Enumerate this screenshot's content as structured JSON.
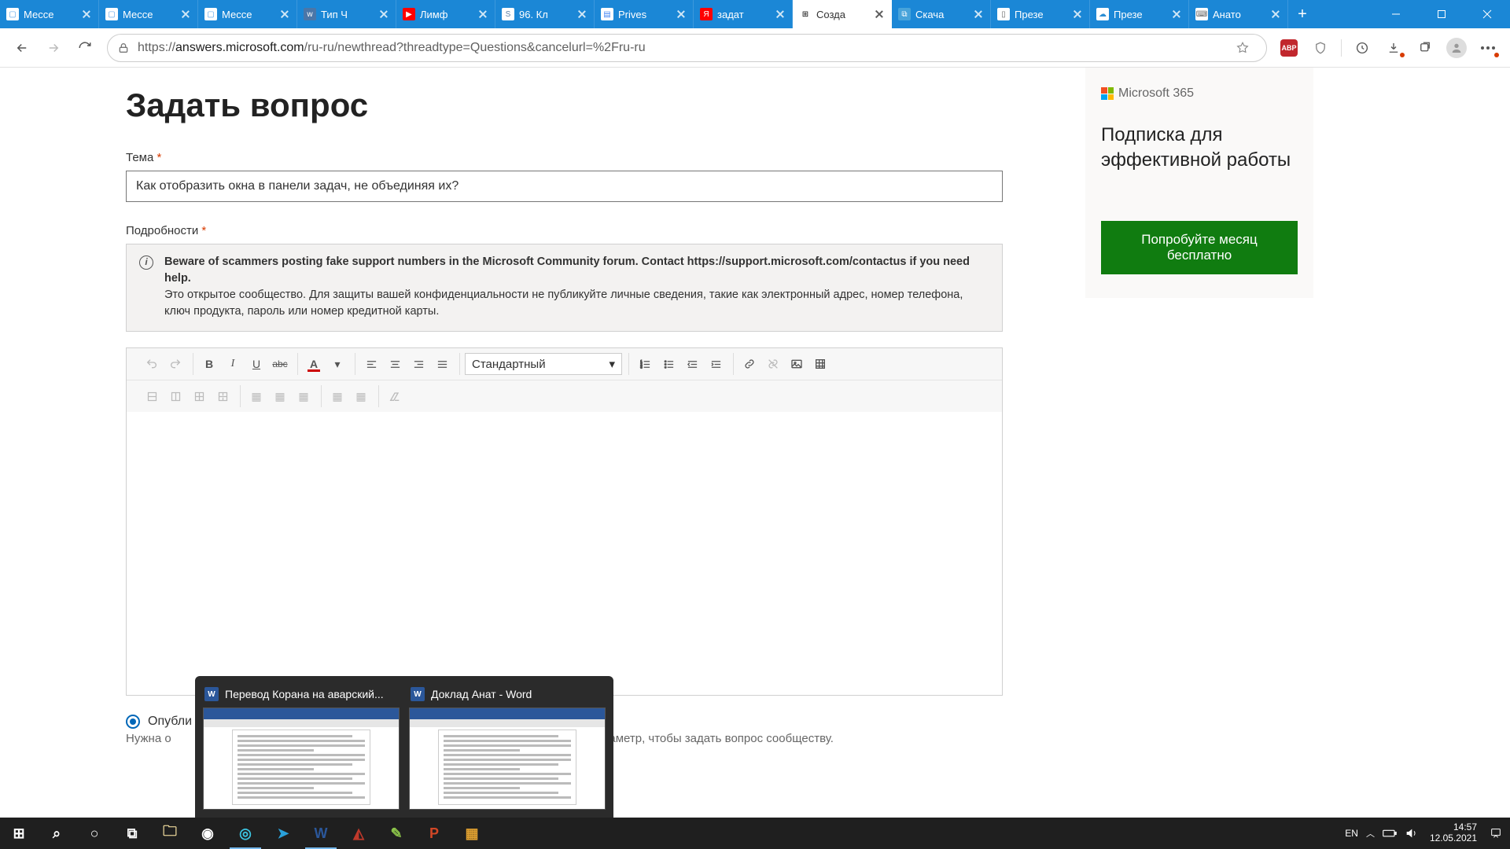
{
  "tabs": [
    {
      "title": "Мессе",
      "fav_bg": "#ffffff",
      "fav_fg": "#54a0e8",
      "fav_txt": "▢"
    },
    {
      "title": "Мессе",
      "fav_bg": "#ffffff",
      "fav_fg": "#54a0e8",
      "fav_txt": "▢"
    },
    {
      "title": "Мессе",
      "fav_bg": "#ffffff",
      "fav_fg": "#54a0e8",
      "fav_txt": "▢"
    },
    {
      "title": "Тип Ч",
      "fav_bg": "#4a76a8",
      "fav_fg": "#ffffff",
      "fav_txt": "w"
    },
    {
      "title": "Лимф",
      "fav_bg": "#ff0000",
      "fav_fg": "#ffffff",
      "fav_txt": "▶"
    },
    {
      "title": "96. Кл",
      "fav_bg": "#ffffff",
      "fav_fg": "#5b7fa6",
      "fav_txt": "S"
    },
    {
      "title": "Prives",
      "fav_bg": "#ffffff",
      "fav_fg": "#4285f4",
      "fav_txt": "▤"
    },
    {
      "title": "задат",
      "fav_bg": "#ff0000",
      "fav_fg": "#ffffff",
      "fav_txt": "Я"
    },
    {
      "title": "Созда",
      "fav_bg": "#ffffff",
      "fav_fg": "#000000",
      "fav_txt": "⊞",
      "active": true
    },
    {
      "title": "Скача",
      "fav_bg": "#47a3da",
      "fav_fg": "#ffffff",
      "fav_txt": "⧉"
    },
    {
      "title": "Презе",
      "fav_bg": "#ffffff",
      "fav_fg": "#666666",
      "fav_txt": "▯"
    },
    {
      "title": "Презе",
      "fav_bg": "#ffffff",
      "fav_fg": "#2a8dd4",
      "fav_txt": "☁"
    },
    {
      "title": "Анато",
      "fav_bg": "#ffffff",
      "fav_fg": "#666666",
      "fav_txt": "⌨"
    }
  ],
  "url": {
    "host": "answers.microsoft.com",
    "path": "/ru-ru/newthread?threadtype=Questions&cancelurl=%2Fru-ru",
    "prefix": "https://"
  },
  "abp_label": "ABP",
  "page_title": "Задать вопрос",
  "subject_label": "Тема",
  "subject_value": "Как отобразить окна в панели задач, не объединяя их?",
  "details_label": "Подробности",
  "info_bold": "Beware of scammers posting fake support numbers in the Microsoft Community forum. Contact https://support.microsoft.com/contactus if you need help.",
  "info_rest": "Это открытое сообщество. Для защиты вашей конфиденциальности не публикуйте личные сведения, такие как электронный адрес, номер телефона, ключ продукта, пароль или номер кредитной карты.",
  "style_select": "Стандартный",
  "font_color_letter": "A",
  "publish_label": "Опубли",
  "publish_hint_prefix": "Нужна о",
  "publish_hint_suffix": "араметр, чтобы задать вопрос сообществу.",
  "promo": {
    "brand": "Microsoft 365",
    "headline": "Подписка для эффективной работы",
    "cta": "Попробуйте месяц бесплатно"
  },
  "previews": [
    {
      "title": "Перевод Корана на аварский..."
    },
    {
      "title": "Доклад Анат - Word"
    }
  ],
  "tray": {
    "lang": "EN",
    "time": "14:57",
    "date": "12.05.2021"
  },
  "task_apps": [
    {
      "name": "start",
      "glyph": "⊞",
      "color": "#ffffff"
    },
    {
      "name": "search",
      "glyph": "⌕",
      "color": "#ffffff"
    },
    {
      "name": "cortana",
      "glyph": "○",
      "color": "#ffffff"
    },
    {
      "name": "taskview",
      "glyph": "⧉",
      "color": "#ffffff"
    },
    {
      "name": "explorer",
      "glyph": "🗀",
      "color": "#ffe9a6"
    },
    {
      "name": "chrome",
      "glyph": "◉",
      "color": "#ffffff"
    },
    {
      "name": "edge",
      "glyph": "◎",
      "color": "#3cc4e0",
      "active": true
    },
    {
      "name": "telegram",
      "glyph": "➤",
      "color": "#2aa1da"
    },
    {
      "name": "word",
      "glyph": "W",
      "color": "#2b579a",
      "active": true
    },
    {
      "name": "app-red",
      "glyph": "◭",
      "color": "#c0392b"
    },
    {
      "name": "notepadpp",
      "glyph": "✎",
      "color": "#8bc34a"
    },
    {
      "name": "powerpoint",
      "glyph": "P",
      "color": "#d24726"
    },
    {
      "name": "app-grid",
      "glyph": "▦",
      "color": "#e0a030"
    }
  ]
}
